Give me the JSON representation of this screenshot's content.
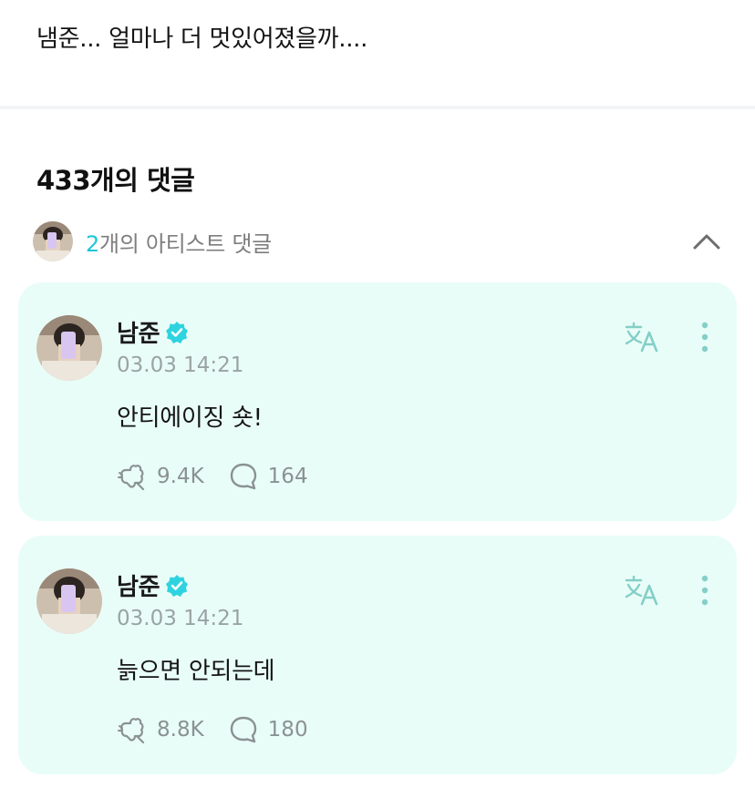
{
  "post": {
    "text": "냄준... 얼마나 더 멋있어졌을까...."
  },
  "comments_header": {
    "title": "433개의 댓글"
  },
  "artist_comments": {
    "count": "2",
    "label": "개의 아티스트 댓글",
    "collapse_icon": "chevron-up-icon"
  },
  "comments": [
    {
      "author": "남준",
      "date": "03.03 14:21",
      "text": "안티에이징 숏!",
      "likes": "9.4K",
      "replies": "164"
    },
    {
      "author": "남준",
      "date": "03.03 14:21",
      "text": "늙으면 안되는데",
      "likes": "8.8K",
      "replies": "180"
    }
  ],
  "colors": {
    "accent": "#1cc6d9",
    "card_bg": "#e9fdf8",
    "verified": "#2fd3e0",
    "muted": "#8a9292"
  }
}
